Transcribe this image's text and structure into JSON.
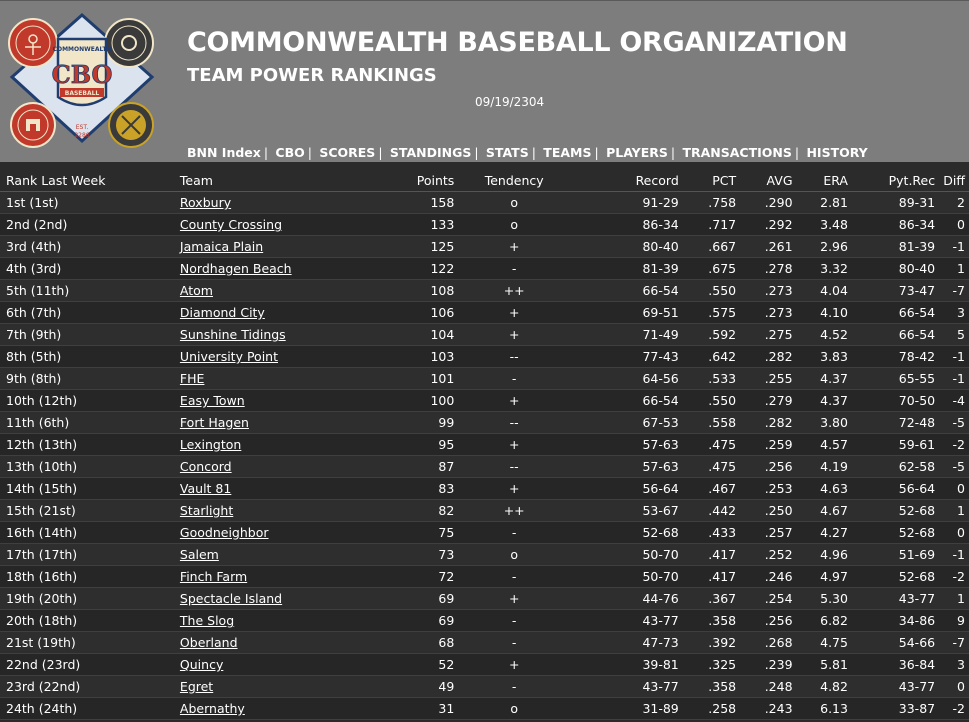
{
  "header": {
    "title": "COMMONWEALTH BASEBALL ORGANIZATION",
    "subtitle": "TEAM POWER RANKINGS",
    "date": "09/19/2304",
    "logo": {
      "center_text": "CBO",
      "top_text": "COMMONWEALTH",
      "ribbon_text": "BASEBALL",
      "est_text": "EST.",
      "est_year": "2286",
      "colors": {
        "red": "#c0392b",
        "navy": "#1f3d6e",
        "cream": "#f2e6c9",
        "gold": "#c9a227"
      }
    }
  },
  "nav": [
    "BNN Index",
    "CBO",
    "SCORES",
    "STANDINGS",
    "STATS",
    "TEAMS",
    "PLAYERS",
    "TRANSACTIONS",
    "HISTORY"
  ],
  "columns": [
    "Rank Last Week",
    "Team",
    "Points",
    "Tendency",
    "Record",
    "PCT",
    "AVG",
    "ERA",
    "Pyt.Rec",
    "Diff"
  ],
  "rows": [
    {
      "rank": "1st (1st)",
      "team": "Roxbury",
      "points": "158",
      "tendency": "o",
      "record": "91-29",
      "pct": ".758",
      "avg": ".290",
      "era": "2.81",
      "pyt": "89-31",
      "diff": "2"
    },
    {
      "rank": "2nd (2nd)",
      "team": "County Crossing",
      "points": "133",
      "tendency": "o",
      "record": "86-34",
      "pct": ".717",
      "avg": ".292",
      "era": "3.48",
      "pyt": "86-34",
      "diff": "0"
    },
    {
      "rank": "3rd (4th)",
      "team": "Jamaica Plain",
      "points": "125",
      "tendency": "+",
      "record": "80-40",
      "pct": ".667",
      "avg": ".261",
      "era": "2.96",
      "pyt": "81-39",
      "diff": "-1"
    },
    {
      "rank": "4th (3rd)",
      "team": "Nordhagen Beach",
      "points": "122",
      "tendency": "-",
      "record": "81-39",
      "pct": ".675",
      "avg": ".278",
      "era": "3.32",
      "pyt": "80-40",
      "diff": "1"
    },
    {
      "rank": "5th (11th)",
      "team": "Atom",
      "points": "108",
      "tendency": "++",
      "record": "66-54",
      "pct": ".550",
      "avg": ".273",
      "era": "4.04",
      "pyt": "73-47",
      "diff": "-7"
    },
    {
      "rank": "6th (7th)",
      "team": "Diamond City",
      "points": "106",
      "tendency": "+",
      "record": "69-51",
      "pct": ".575",
      "avg": ".273",
      "era": "4.10",
      "pyt": "66-54",
      "diff": "3"
    },
    {
      "rank": "7th (9th)",
      "team": "Sunshine Tidings",
      "points": "104",
      "tendency": "+",
      "record": "71-49",
      "pct": ".592",
      "avg": ".275",
      "era": "4.52",
      "pyt": "66-54",
      "diff": "5"
    },
    {
      "rank": "8th (5th)",
      "team": "University Point",
      "points": "103",
      "tendency": "--",
      "record": "77-43",
      "pct": ".642",
      "avg": ".282",
      "era": "3.83",
      "pyt": "78-42",
      "diff": "-1"
    },
    {
      "rank": "9th (8th)",
      "team": "FHE",
      "points": "101",
      "tendency": "-",
      "record": "64-56",
      "pct": ".533",
      "avg": ".255",
      "era": "4.37",
      "pyt": "65-55",
      "diff": "-1"
    },
    {
      "rank": "10th (12th)",
      "team": "Easy Town",
      "points": "100",
      "tendency": "+",
      "record": "66-54",
      "pct": ".550",
      "avg": ".279",
      "era": "4.37",
      "pyt": "70-50",
      "diff": "-4"
    },
    {
      "rank": "11th (6th)",
      "team": "Fort Hagen",
      "points": "99",
      "tendency": "--",
      "record": "67-53",
      "pct": ".558",
      "avg": ".282",
      "era": "3.80",
      "pyt": "72-48",
      "diff": "-5"
    },
    {
      "rank": "12th (13th)",
      "team": "Lexington",
      "points": "95",
      "tendency": "+",
      "record": "57-63",
      "pct": ".475",
      "avg": ".259",
      "era": "4.57",
      "pyt": "59-61",
      "diff": "-2"
    },
    {
      "rank": "13th (10th)",
      "team": "Concord",
      "points": "87",
      "tendency": "--",
      "record": "57-63",
      "pct": ".475",
      "avg": ".256",
      "era": "4.19",
      "pyt": "62-58",
      "diff": "-5"
    },
    {
      "rank": "14th (15th)",
      "team": "Vault 81",
      "points": "83",
      "tendency": "+",
      "record": "56-64",
      "pct": ".467",
      "avg": ".253",
      "era": "4.63",
      "pyt": "56-64",
      "diff": "0"
    },
    {
      "rank": "15th (21st)",
      "team": "Starlight",
      "points": "82",
      "tendency": "++",
      "record": "53-67",
      "pct": ".442",
      "avg": ".250",
      "era": "4.67",
      "pyt": "52-68",
      "diff": "1"
    },
    {
      "rank": "16th (14th)",
      "team": "Goodneighbor",
      "points": "75",
      "tendency": "-",
      "record": "52-68",
      "pct": ".433",
      "avg": ".257",
      "era": "4.27",
      "pyt": "52-68",
      "diff": "0"
    },
    {
      "rank": "17th (17th)",
      "team": "Salem",
      "points": "73",
      "tendency": "o",
      "record": "50-70",
      "pct": ".417",
      "avg": ".252",
      "era": "4.96",
      "pyt": "51-69",
      "diff": "-1"
    },
    {
      "rank": "18th (16th)",
      "team": "Finch Farm",
      "points": "72",
      "tendency": "-",
      "record": "50-70",
      "pct": ".417",
      "avg": ".246",
      "era": "4.97",
      "pyt": "52-68",
      "diff": "-2"
    },
    {
      "rank": "19th (20th)",
      "team": "Spectacle Island",
      "points": "69",
      "tendency": "+",
      "record": "44-76",
      "pct": ".367",
      "avg": ".254",
      "era": "5.30",
      "pyt": "43-77",
      "diff": "1"
    },
    {
      "rank": "20th (18th)",
      "team": "The Slog",
      "points": "69",
      "tendency": "-",
      "record": "43-77",
      "pct": ".358",
      "avg": ".256",
      "era": "6.82",
      "pyt": "34-86",
      "diff": "9"
    },
    {
      "rank": "21st (19th)",
      "team": "Oberland",
      "points": "68",
      "tendency": "-",
      "record": "47-73",
      "pct": ".392",
      "avg": ".268",
      "era": "4.75",
      "pyt": "54-66",
      "diff": "-7"
    },
    {
      "rank": "22nd (23rd)",
      "team": "Quincy",
      "points": "52",
      "tendency": "+",
      "record": "39-81",
      "pct": ".325",
      "avg": ".239",
      "era": "5.81",
      "pyt": "36-84",
      "diff": "3"
    },
    {
      "rank": "23rd (22nd)",
      "team": "Egret",
      "points": "49",
      "tendency": "-",
      "record": "43-77",
      "pct": ".358",
      "avg": ".248",
      "era": "4.82",
      "pyt": "43-77",
      "diff": "0"
    },
    {
      "rank": "24th (24th)",
      "team": "Abernathy",
      "points": "31",
      "tendency": "o",
      "record": "31-89",
      "pct": ".258",
      "avg": ".243",
      "era": "6.13",
      "pyt": "33-87",
      "diff": "-2"
    }
  ]
}
